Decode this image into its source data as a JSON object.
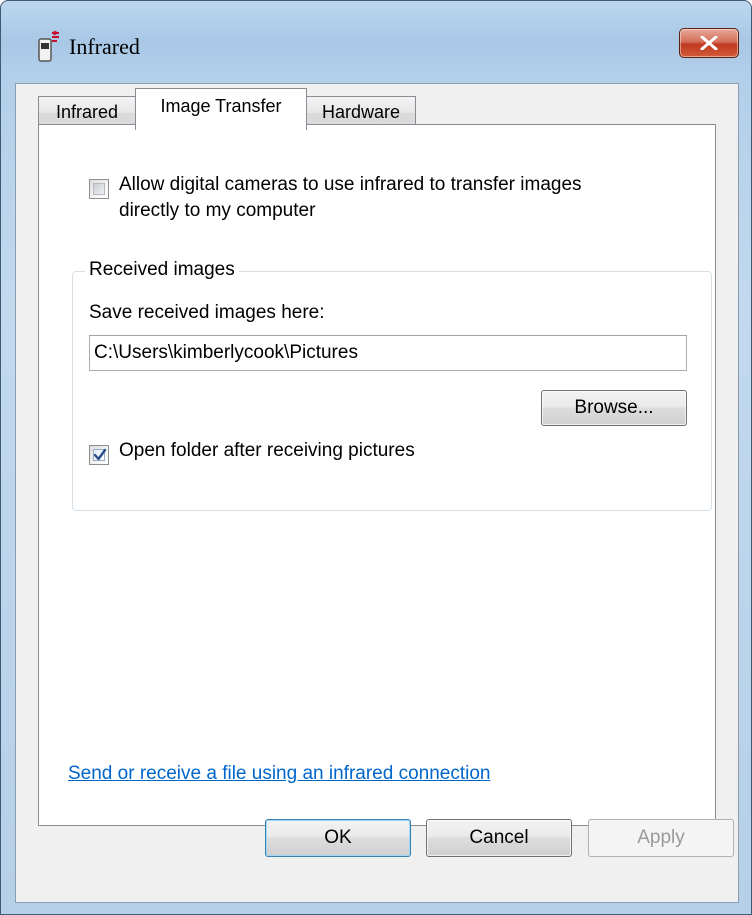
{
  "window": {
    "title": "Infrared",
    "icon": "infrared-device-icon",
    "close_icon": "close-icon"
  },
  "tabs": [
    {
      "label": "Infrared",
      "selected": false
    },
    {
      "label": "Image Transfer",
      "selected": true
    },
    {
      "label": "Hardware",
      "selected": false
    }
  ],
  "image_transfer": {
    "allow_cameras": {
      "line1": "Allow digital cameras to use infrared to transfer images",
      "line2": "directly to my computer",
      "checked": false
    },
    "received_images": {
      "legend": "Received images",
      "save_label": "Save received images here:",
      "save_path": "C:\\Users\\kimberlycook\\Pictures",
      "browse_label": "Browse...",
      "open_folder": {
        "label": "Open folder after receiving pictures",
        "checked": true
      }
    },
    "send_link": "Send or receive a file using an infrared connection"
  },
  "footer": {
    "ok_label": "OK",
    "cancel_label": "Cancel",
    "apply_label": "Apply",
    "apply_enabled": false
  }
}
